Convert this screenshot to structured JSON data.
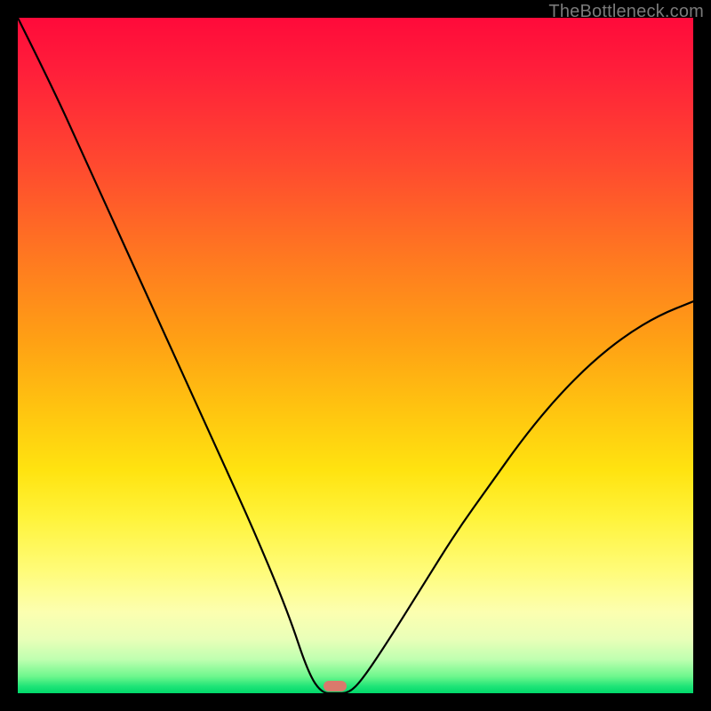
{
  "watermark": {
    "text": "TheBottleneck.com"
  },
  "marker": {
    "label": "optimal-point",
    "color": "#d97a6c",
    "x_fraction": 0.47
  },
  "chart_data": {
    "type": "line",
    "title": "",
    "xlabel": "",
    "ylabel": "",
    "xlim": [
      0,
      100
    ],
    "ylim": [
      0,
      100
    ],
    "grid": false,
    "legend": false,
    "annotations": [],
    "series": [
      {
        "name": "bottleneck-curve",
        "x": [
          0,
          5,
          10,
          15,
          20,
          25,
          30,
          35,
          40,
          43,
          45,
          47,
          49,
          51,
          55,
          60,
          65,
          70,
          75,
          80,
          85,
          90,
          95,
          100
        ],
        "y": [
          100,
          90,
          79,
          68,
          57,
          46,
          35,
          24,
          12,
          3,
          0,
          0,
          0,
          2,
          8,
          16,
          24,
          31,
          38,
          44,
          49,
          53,
          56,
          58
        ]
      }
    ],
    "background_gradient": {
      "direction": "vertical",
      "stops": [
        {
          "pos": 0.0,
          "color": "#ff0a3a"
        },
        {
          "pos": 0.36,
          "color": "#ff7a20"
        },
        {
          "pos": 0.67,
          "color": "#ffe310"
        },
        {
          "pos": 0.88,
          "color": "#fcffb0"
        },
        {
          "pos": 1.0,
          "color": "#00d86a"
        }
      ]
    },
    "marker": {
      "x": 47,
      "y": 0,
      "color": "#d97a6c"
    }
  }
}
